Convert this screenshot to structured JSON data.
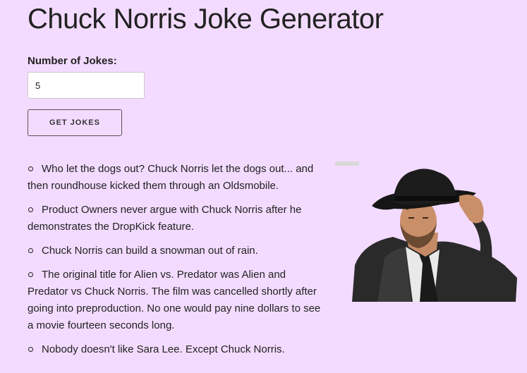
{
  "page": {
    "title": "Chuck Norris Joke Generator"
  },
  "form": {
    "label": "Number of Jokes:",
    "value": "5",
    "button_label": "GET JOKES"
  },
  "jokes": [
    "Who let the dogs out? Chuck Norris let the dogs out... and then roundhouse kicked them through an Oldsmobile.",
    "Product Owners never argue with Chuck Norris after he demonstrates the DropKick feature.",
    "Chuck Norris can build a snowman out of rain.",
    "The original title for Alien vs. Predator was Alien and Predator vs Chuck Norris. The film was cancelled shortly after going into preproduction. No one would pay nine dollars to see a movie fourteen seconds long.",
    "Nobody doesn't like Sara Lee. Except Chuck Norris."
  ],
  "colors": {
    "background": "#f3dbff",
    "text": "#222222"
  }
}
